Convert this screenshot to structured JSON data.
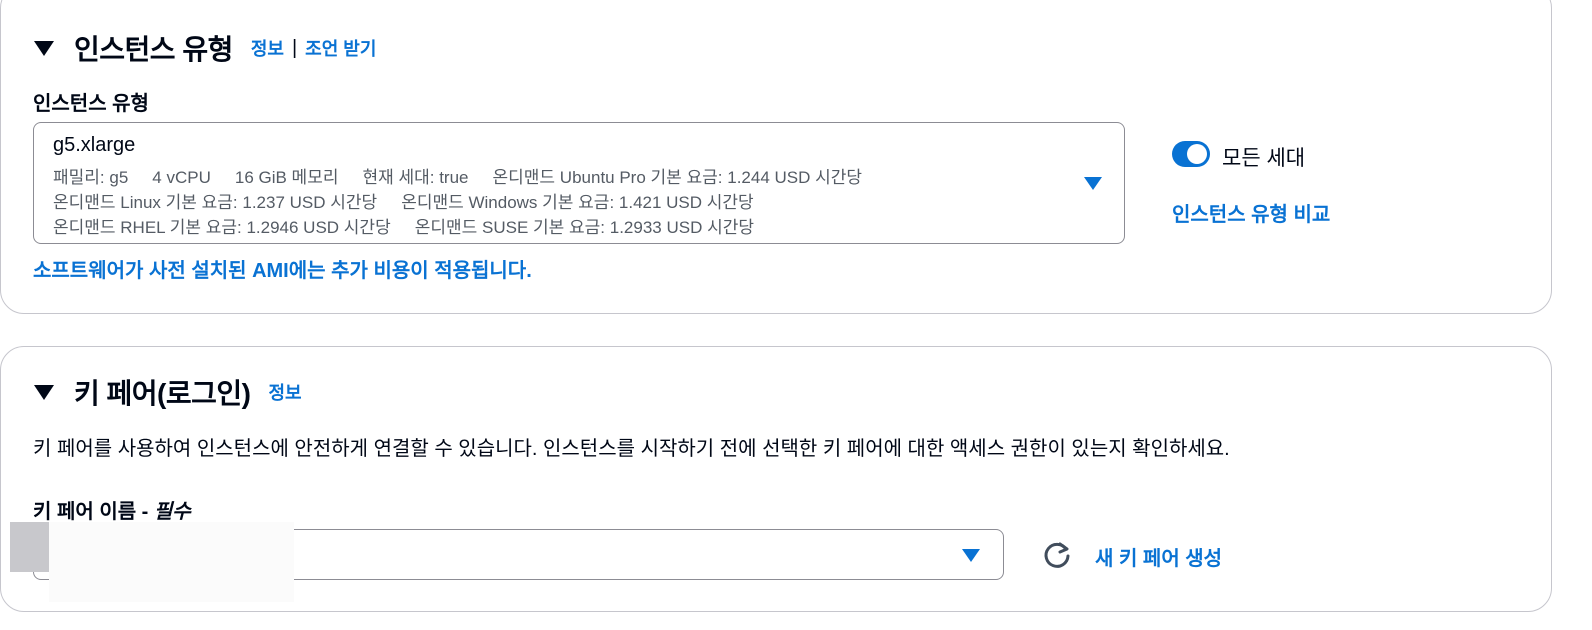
{
  "instance_type_section": {
    "title": "인스턴스 유형",
    "info_link": "정보",
    "separator": "|",
    "advice_link": "조언 받기",
    "field_label": "인스턴스 유형",
    "selected": {
      "value": "g5.xlarge",
      "line1": [
        "패밀리: g5",
        "4 vCPU",
        "16 GiB 메모리",
        "현재 세대: true",
        "온디맨드 Ubuntu Pro 기본 요금: 1.244 USD 시간당"
      ],
      "line2": [
        "온디맨드 Linux 기본 요금: 1.237 USD 시간당",
        "온디맨드 Windows 기본 요금: 1.421 USD 시간당"
      ],
      "line3": [
        "온디맨드 RHEL 기본 요금: 1.2946 USD 시간당",
        "온디맨드 SUSE 기본 요금: 1.2933 USD 시간당"
      ]
    },
    "ami_notice": "소프트웨어가 사전 설치된 AMI에는 추가 비용이 적용됩니다.",
    "all_generations_label": "모든 세대",
    "all_generations_enabled": true,
    "compare_link": "인스턴스 유형 비교"
  },
  "key_pair_section": {
    "title": "키 페어(로그인)",
    "info_link": "정보",
    "description": "키 페어를 사용하여 인스턴스에 안전하게 연결할 수 있습니다. 인스턴스를 시작하기 전에 선택한 키 페어에 대한 액세스 권한이 있는지 확인하세요.",
    "field_label": "키 페어 이름 - ",
    "required_label": "필수",
    "selected_value": "",
    "create_link": "새 키 페어 생성"
  },
  "colors": {
    "accent": "#0972d3",
    "text": "#000716",
    "secondary_text": "#545b64",
    "border": "#8c8c94"
  },
  "icons": [
    "caret-down-icon",
    "refresh-icon",
    "toggle-switch"
  ]
}
